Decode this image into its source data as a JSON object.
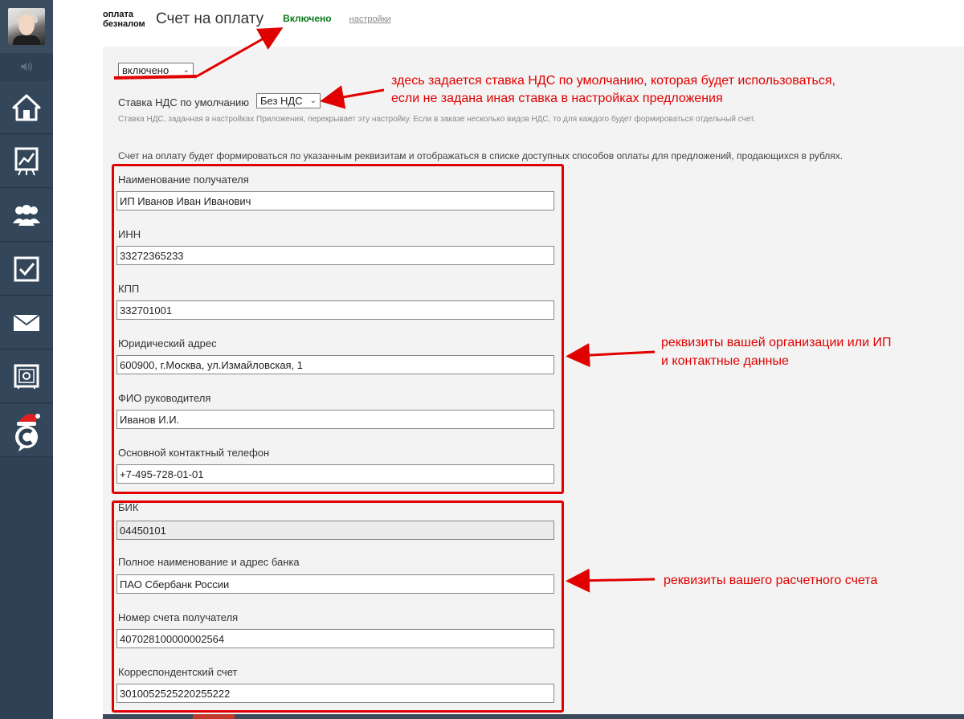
{
  "header": {
    "logo_text": "оплата\nбезналом",
    "title": "Счет на оплату",
    "status": "Включено",
    "settings_link": "настройки"
  },
  "sidebar": {
    "items": [
      {
        "icon": "home-icon"
      },
      {
        "icon": "chart-icon"
      },
      {
        "icon": "users-icon"
      },
      {
        "icon": "checkbox-icon"
      },
      {
        "icon": "mail-icon"
      },
      {
        "icon": "safe-icon"
      },
      {
        "icon": "santa-c-icon"
      }
    ]
  },
  "form": {
    "enabled_select": "включено",
    "vat_label": "Ставка НДС по умолчанию",
    "vat_select": "Без НДС",
    "vat_hint": "Ставка НДС, заданная в настройках Приложения, перекрывает эту настройку. Если в заказе несколько видов НДС, то для каждого будет формироваться отдельный счет.",
    "description": "Счет на оплату будет формироваться по указанным реквизитам и отображаться в списке доступных способов оплаты для предложений, продающихся в рублях.",
    "org_fields": [
      {
        "label": "Наименование получателя",
        "value": "ИП Иванов Иван Иванович"
      },
      {
        "label": "ИНН",
        "value": "33272365233"
      },
      {
        "label": "КПП",
        "value": "332701001"
      },
      {
        "label": "Юридический адрес",
        "value": "600900, г.Москва, ул.Измайловская, 1"
      },
      {
        "label": "ФИО руководителя",
        "value": "Иванов И.И."
      },
      {
        "label": "Основной контактный телефон",
        "value": "+7-495-728-01-01"
      }
    ],
    "bank_fields": [
      {
        "label": "БИК",
        "value": "04450101"
      },
      {
        "label": "Полное наименование и адрес банка",
        "value": "ПАО Сбербанк России"
      },
      {
        "label": "Номер счета получателя",
        "value": "407028100000002564"
      },
      {
        "label": "Корреспондентский счет",
        "value": "301005252522025 5222"
      }
    ]
  },
  "annotations": {
    "vat_line1": "здесь задается ставка НДС по умолчанию, которая будет использоваться,",
    "vat_line2": "если не задана иная ставка в настройках предложения",
    "org_line1": "реквизиты вашей организации или ИП",
    "org_line2": "и контактные данные",
    "bank": "реквизиты вашего расчетного счета"
  },
  "colors": {
    "sidebar": "#2f4152",
    "annotation_red": "#e00000",
    "status_green": "#0a7a1a",
    "panel_bg": "#f3f3f3"
  }
}
